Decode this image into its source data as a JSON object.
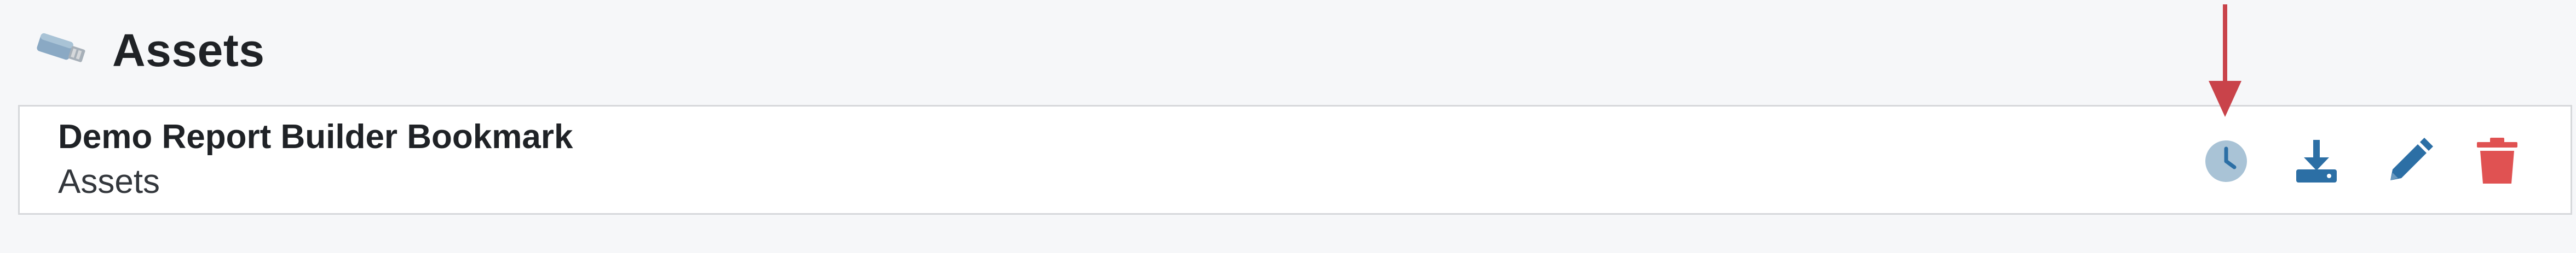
{
  "page": {
    "title": "Assets",
    "title_icon": "asset-tag-icon"
  },
  "item": {
    "name": "Demo Report Builder Bookmark",
    "category": "Assets",
    "actions": [
      {
        "name": "schedule",
        "icon": "clock-icon",
        "color": "#a9c3d6"
      },
      {
        "name": "download",
        "icon": "download-icon",
        "color": "#2c6fa5"
      },
      {
        "name": "edit",
        "icon": "pencil-icon",
        "color": "#2c6fa5"
      },
      {
        "name": "delete",
        "icon": "trash-icon",
        "color": "#e05252"
      }
    ]
  },
  "annotation": {
    "icon": "red-arrow-icon",
    "color": "#c9434a",
    "points_to": "schedule"
  }
}
